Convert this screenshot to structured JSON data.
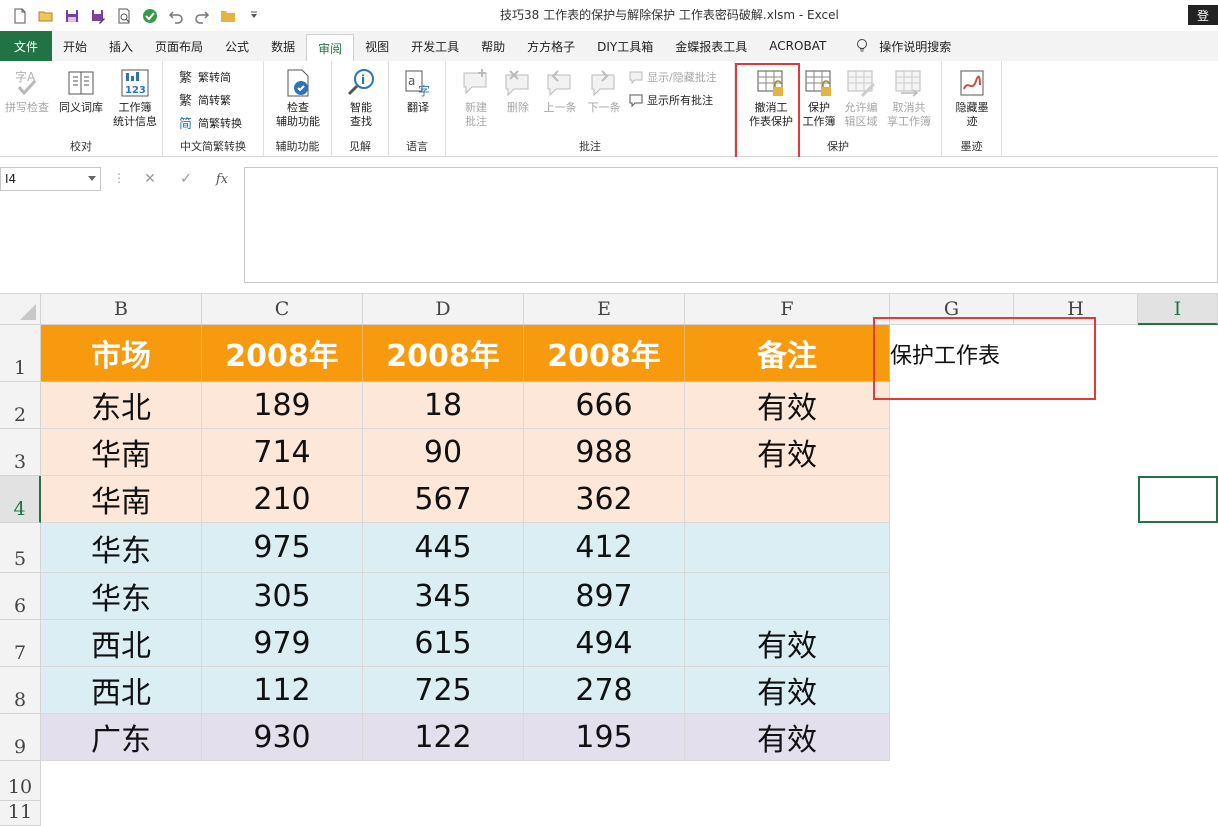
{
  "title_bar": {
    "document_title": "技巧38  工作表的保护与解除保护 工作表密码破解.xlsm  -  Excel",
    "login_label": "登",
    "qat_icons": [
      "new-file-icon",
      "open-folder-icon",
      "save-icon",
      "save-as-icon",
      "print-preview-icon",
      "check-icon",
      "undo-icon",
      "redo-icon",
      "folder-icon",
      "customize-icon"
    ]
  },
  "tabs": {
    "file": "文件",
    "items": [
      "开始",
      "插入",
      "页面布局",
      "公式",
      "数据",
      "审阅",
      "视图",
      "开发工具",
      "帮助",
      "方方格子",
      "DIY工具箱",
      "金蝶报表工具",
      "ACROBAT"
    ],
    "active": "审阅",
    "search_label": "操作说明搜索"
  },
  "ribbon": {
    "groups": {
      "proofing": {
        "label": "校对",
        "spell_check": "拼写检查",
        "thesaurus": "同义词库",
        "workbook_stats_line1": "工作簿",
        "workbook_stats_line2": "统计信息"
      },
      "chinese_conversion": {
        "label": "中文简繁转换",
        "to_simplified": "繁转简",
        "to_traditional": "简转繁",
        "convert": "简繁转换"
      },
      "accessibility": {
        "label": "辅助功能",
        "check_line1": "检查",
        "check_line2": "辅助功能"
      },
      "insights": {
        "label": "见解",
        "smart_lookup_line1": "智能",
        "smart_lookup_line2": "查找"
      },
      "language": {
        "label": "语言",
        "translate": "翻译"
      },
      "comments": {
        "label": "批注",
        "new_line1": "新建",
        "new_line2": "批注",
        "delete": "删除",
        "previous": "上一条",
        "next": "下一条",
        "show_hide": "显示/隐藏批注",
        "show_all": "显示所有批注"
      },
      "protect": {
        "label": "保护",
        "unprotect_line1": "撤消工",
        "unprotect_line2": "作表保护",
        "protect_workbook_line1": "保护",
        "protect_workbook_line2": "工作簿",
        "allow_edit_line1": "允许编",
        "allow_edit_line2": "辑区域",
        "unshare_line1": "取消共",
        "unshare_line2": "享工作簿"
      },
      "ink": {
        "label": "墨迹",
        "hide_ink_line1": "隐藏墨",
        "hide_ink_line2": "迹"
      }
    }
  },
  "formula_bar": {
    "name_box": "I4",
    "cancel_glyph": "✕",
    "enter_glyph": "✓",
    "fx_label": "fx",
    "formula_value": ""
  },
  "sheet": {
    "column_headers": [
      "B",
      "C",
      "D",
      "E",
      "F",
      "G",
      "H",
      "I"
    ],
    "row_headers": [
      "1",
      "2",
      "3",
      "4",
      "5",
      "6",
      "7",
      "8",
      "9",
      "10",
      "11"
    ],
    "active_cell": "I4",
    "header_row": [
      "市场",
      "2008年",
      "2008年",
      "2008年",
      "备注"
    ],
    "rows": [
      [
        "东北",
        "189",
        "18",
        "666",
        "有效"
      ],
      [
        "华南",
        "714",
        "90",
        "988",
        "有效"
      ],
      [
        "华南",
        "210",
        "567",
        "362",
        ""
      ],
      [
        "华东",
        "975",
        "445",
        "412",
        ""
      ],
      [
        "华东",
        "305",
        "345",
        "897",
        ""
      ],
      [
        "西北",
        "979",
        "615",
        "494",
        "有效"
      ],
      [
        "西北",
        "112",
        "725",
        "278",
        "有效"
      ],
      [
        "广东",
        "930",
        "122",
        "195",
        "有效"
      ]
    ],
    "note_cell_text": "保护工作表",
    "colors": {
      "header_fill": "#f79a0e",
      "peach_fill": "#fce7d9",
      "blue_fill": "#daeef3",
      "lavender_fill": "#e3dfed",
      "highlight_border": "#e03a3a",
      "accent": "#217346"
    }
  }
}
